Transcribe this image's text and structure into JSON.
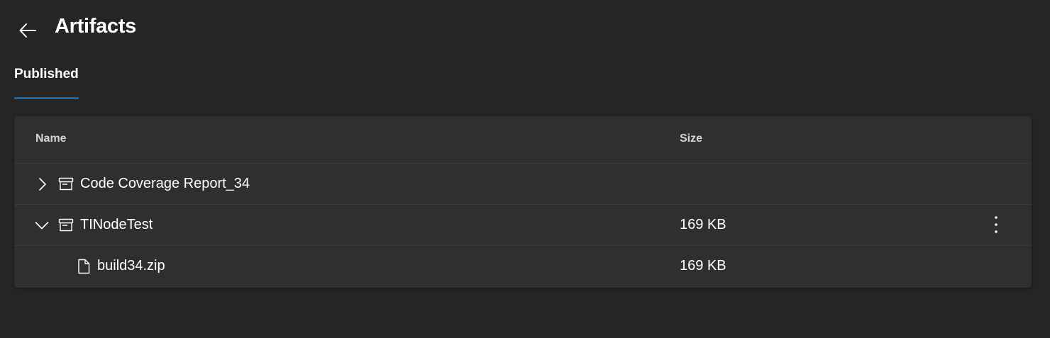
{
  "header": {
    "title": "Artifacts",
    "back_icon": "arrow-left-icon"
  },
  "tabs": [
    {
      "label": "Published",
      "selected": true
    }
  ],
  "table": {
    "columns": {
      "name": "Name",
      "size": "Size"
    },
    "rows": [
      {
        "name": "Code Coverage Report_34",
        "size": "",
        "expanded": false,
        "icon": "archive-icon"
      },
      {
        "name": "TINodeTest",
        "size": "169 KB",
        "expanded": true,
        "icon": "archive-icon",
        "has_menu": true
      },
      {
        "name": "build34.zip",
        "size": "169 KB",
        "icon": "file-icon",
        "level": 1
      }
    ]
  },
  "colors": {
    "background": "#262524",
    "card": "#302f2e",
    "accent": "#0f6cbd",
    "text": "#ffffff"
  }
}
